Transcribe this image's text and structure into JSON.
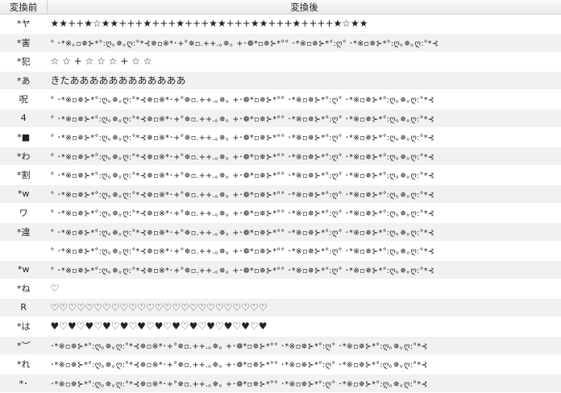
{
  "headers": {
    "before": "変換前",
    "after": "変換後"
  },
  "rows": [
    {
      "before": "*ヤ",
      "after": "★★++★☆★★+++★+++★+++★★+++★★+++★++++★☆★★",
      "style": "big",
      "alt": false
    },
    {
      "before": "*害",
      "after": "° ･*※｡▫✵⊱*°:ღ｡✵｡ღ:°*⊰✵▫※*･+°✵▫.++.｡✵｡ +･❁*▫✵⊱*°° ･*※▫✵⊱*°:ღ° ･*※▫✵⊱*°:ღ｡✵｡ღ:°*⊰",
      "style": "sym",
      "alt": true
    },
    {
      "before": "*犯",
      "after": "    ☆             ☆      +    ☆       ☆                 ☆      +    ☆        ☆",
      "style": "big",
      "alt": false
    },
    {
      "before": "*あ",
      "after": "きたああああああああああああ",
      "style": "big",
      "alt": true
    },
    {
      "before": "呪",
      "after": "° ･*※▫✵⊱*°:ღ｡✵｡ღ:°*⊰✵▫※*･+°✵▫.++.｡✵｡ +･❁*▫✵⊱*°° ･*※▫✵⊱*°:ღ° ･*※▫✵⊱*°:ღ｡✵｡ღ:°*⊰",
      "style": "sym",
      "alt": false
    },
    {
      "before": "4",
      "after": "° ･*※▫✵⊱*°:ღ｡✵｡ღ:°*⊰✵▫※*･+°✵▫.++.｡✵｡ +･❁*▫✵⊱*°° ･*※▫✵⊱*°:ღ° ･*※▫✵⊱*°:ღ｡✵｡ღ:°*⊰",
      "style": "sym",
      "alt": true
    },
    {
      "before": "*■",
      "after": "° ･*※▫✵⊱*°:ღ｡✵｡ღ:°*⊰✵▫※*･+°✵▫.++.｡✵｡ +･❁*▫✵⊱*°° ･*※▫✵⊱*°:ღ° ･*※▫✵⊱*°:ღ｡✵｡ღ:°*⊰",
      "style": "sym",
      "alt": false
    },
    {
      "before": "*わ",
      "after": "° ･*※▫✵⊱*°:ღ｡✵｡ღ:°*⊰✵▫※*･+°✵▫.++.｡✵｡ +･❁*▫✵⊱*°° ･*※▫✵⊱*°:ღ° ･*※▫✵⊱*°:ღ｡✵｡ღ:°*⊰",
      "style": "sym",
      "alt": true
    },
    {
      "before": "*割",
      "after": "° ･*※▫✵⊱*°:ღ｡✵｡ღ:°*⊰✵▫※*･+°✵▫.++.｡✵｡ +･❁*▫✵⊱*°° ･*※▫✵⊱*°:ღ° ･*※▫✵⊱*°:ღ｡✵｡ღ:°*⊰",
      "style": "sym",
      "alt": false
    },
    {
      "before": "*w",
      "after": "° ･*※▫✵⊱*°:ღ｡✵｡ღ:°*⊰✵▫※*･+°✵▫.++.｡✵｡ +･❁*▫✵⊱*°° ･*※▫✵⊱*°:ღ° ･*※▫✵⊱*°:ღ｡✵｡ღ:°*⊰",
      "style": "sym",
      "alt": true
    },
    {
      "before": "ワ",
      "after": "° ･*※▫✵⊱*°:ღ｡✵｡ღ:°*⊰✵▫※*･+°✵▫.++.｡✵｡ +･❁*▫✵⊱*°° ･*※▫✵⊱*°:ღ° ･*※▫✵⊱*°:ღ｡✵｡ღ:°*⊰",
      "style": "sym",
      "alt": false
    },
    {
      "before": "*違",
      "after": "° ･*※▫✵⊱*°:ღ｡✵｡ღ:°*⊰✵▫※*･+°✵▫.++.｡✵｡ +･❁*▫✵⊱*°° ･*※▫✵⊱*°:ღ° ･*※▫✵⊱*°:ღ｡✵｡ღ:°*⊰",
      "style": "sym",
      "alt": true
    },
    {
      "before": "",
      "after": "° ･*※▫✵⊱*°:ღ｡✵｡ღ:°*⊰✵▫※*･+°✵▫.++.｡✵｡ +･❁*▫✵⊱*°° ･*※▫✵⊱*°:ღ° ･*※▫✵⊱*°:ღ｡✵｡ღ:°*⊰",
      "style": "sym",
      "alt": false
    },
    {
      "before": "*w",
      "after": "° ･*※▫✵⊱*°:ღ｡✵｡ღ:°*⊰✵▫※*･+°✵▫.++.｡✵｡ +･❁*▫✵⊱*°° ･*※▫✵⊱*°:ღ° ･*※▫✵⊱*°:ღ｡✵｡ღ:°*⊰",
      "style": "sym",
      "alt": true
    },
    {
      "before": "*ね",
      "after": "♡",
      "style": "big",
      "alt": false
    },
    {
      "before": "R",
      "after": "♡♡♡♡♡♡♡♡♡♡♡♡♡♡♡♡♡♡♡♡♡♡♡♡♡",
      "style": "big",
      "alt": true
    },
    {
      "before": "*は",
      "after": "♥♡♥♡♥♡♥♡♥♡♥♡♥♡♥♡♥♡♥♡♥♡♥♡♥",
      "style": "big",
      "alt": false
    },
    {
      "before": "*︶",
      "after": "･*※▫✵⊱*°:ღ｡✵｡ღ:°*⊰✵▫※*･+°✵▫.++.｡✵｡ +･❁*▫✵⊱*°° ･*※▫✵⊱*°:ღ° ･*※▫✵⊱*°:ღ｡✵｡ღ:°*⊰",
      "style": "sym",
      "alt": true
    },
    {
      "before": "*れ",
      "after": "･*※▫✵⊱*°:ღ｡✵｡ღ:°*⊰✵▫※*･+°✵▫.++.｡✵｡ +･❁*▫✵⊱*°° ･*※▫✵⊱*°:ღ° ･*※▫✵⊱*°:ღ｡✵｡ღ:°*⊰",
      "style": "sym",
      "alt": false
    },
    {
      "before": "*･",
      "after": "･*※▫✵⊱*°:ღ｡✵｡ღ:°*⊰✵▫※*･+°✵▫.++.｡✵｡ +･❁*▫✵⊱*°° ･*※▫✵⊱*°:ღ° ･*※▫✵⊱*°:ღ｡✵｡ღ:°*⊰",
      "style": "sym",
      "alt": true
    }
  ]
}
